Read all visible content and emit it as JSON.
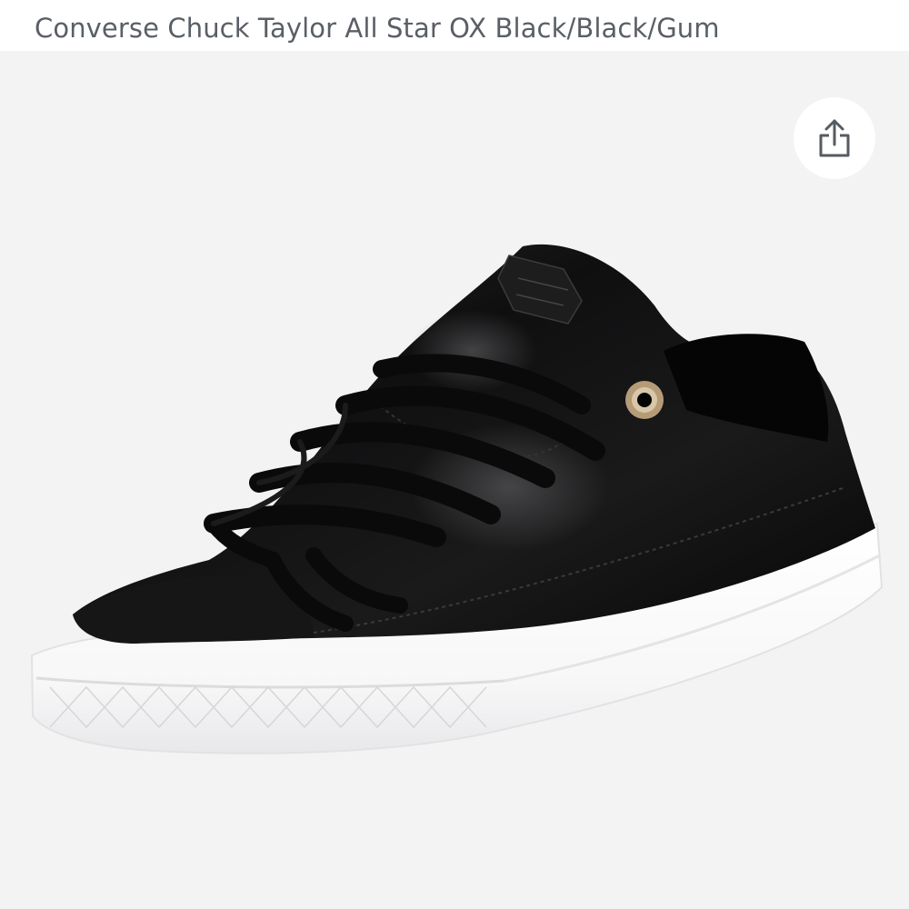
{
  "product": {
    "title": "Converse Chuck Taylor All Star OX Black/Black/Gum"
  },
  "image": {
    "subject": "Converse Chuck Taylor All Star low-top sneaker",
    "upper_color": "#111111",
    "sole_color": "#ffffff",
    "background_color": "#f3f3f4"
  },
  "share": {
    "icon": "share-icon"
  },
  "colors": {
    "title_text": "#5a5f66",
    "icon": "#555b62"
  }
}
